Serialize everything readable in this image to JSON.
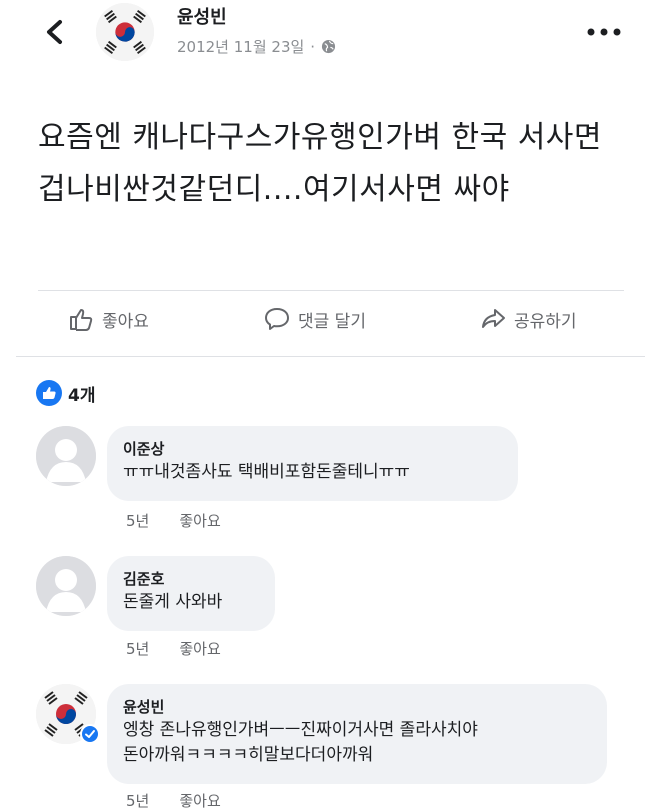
{
  "post": {
    "author": "윤성빈",
    "date": "2012년 11월 23일",
    "separator": "·",
    "privacy_icon": "globe-icon",
    "more_icon": "more-horizontal-icon",
    "back_icon": "chevron-left-icon",
    "text": "요즘엔 캐나다구스가유행인가벼 한국 서사면겁나비싼것같던디....여기서사면 싸야"
  },
  "actions": {
    "like": "좋아요",
    "comment": "댓글 달기",
    "share": "공유하기"
  },
  "reactions": {
    "count": "4개",
    "icon": "like-icon",
    "color": "#1877f2"
  },
  "comments": [
    {
      "name": "이준상",
      "text": "ㅠㅠ내것좀사됴 택배비포함돈줄테니ㅠㅠ",
      "time": "5년",
      "like": "좋아요"
    },
    {
      "name": "김준호",
      "text": "돈줄게 사와바",
      "time": "5년",
      "like": "좋아요"
    },
    {
      "name": "윤성빈",
      "text": "엥창 존나유행인가벼ㅡㅡ진짜이거사면 졸라사치야\n돈아까워ㅋㅋㅋㅋ히말보다더아까워",
      "time": "5년",
      "like": "좋아요"
    }
  ],
  "colors": {
    "accent": "#1877f2",
    "bubble": "#f0f2f5",
    "secondary_text": "#65676b"
  }
}
